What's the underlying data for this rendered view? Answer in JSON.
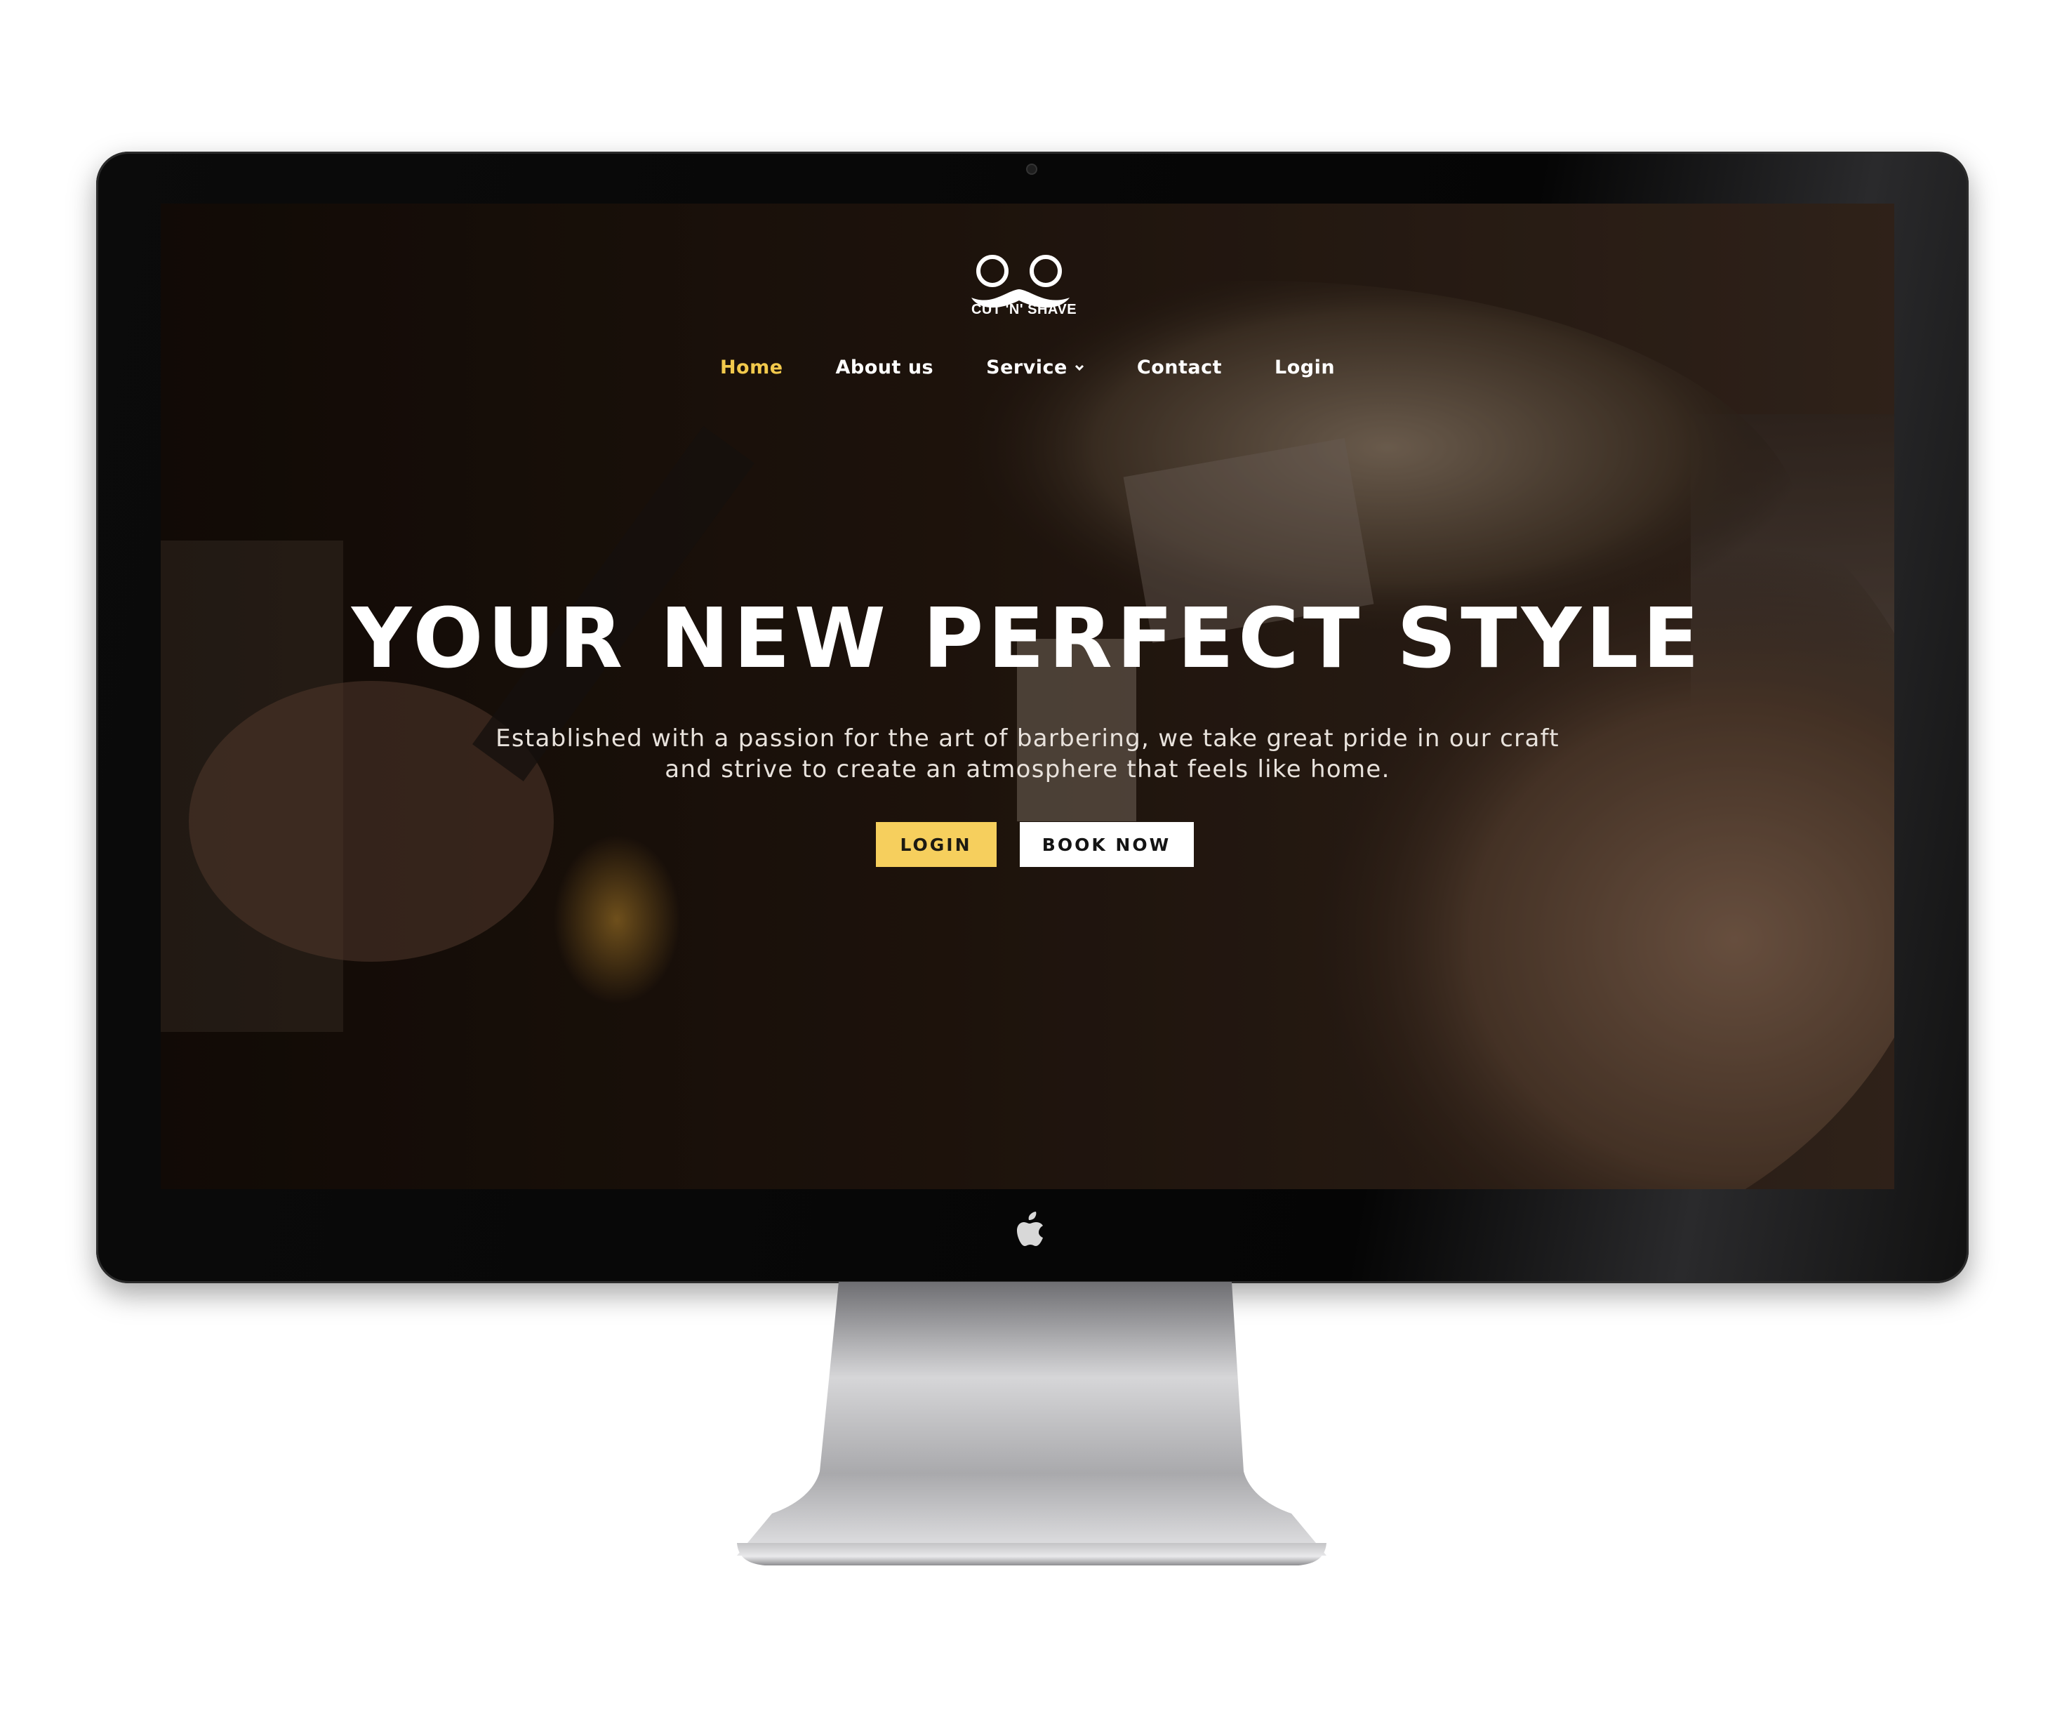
{
  "site": {
    "logo_text": "CUT 'N' SHAVE",
    "logo_icon": "scissors-mustache-icon"
  },
  "nav": {
    "items": [
      {
        "label": "Home",
        "active": true
      },
      {
        "label": "About us",
        "active": false
      },
      {
        "label": "Service",
        "active": false,
        "has_dropdown": true
      },
      {
        "label": "Contact",
        "active": false
      },
      {
        "label": "Login",
        "active": false
      }
    ]
  },
  "hero": {
    "title": "YOUR NEW PERFECT STYLE",
    "subtitle_line1": "Established with a passion for the art of barbering, we take great pride in our craft",
    "subtitle_line2": "and strive to create an atmosphere that feels like home.",
    "login_button": "LOGIN",
    "book_button": "BOOK NOW"
  },
  "colors": {
    "accent": "#f6cf5d",
    "nav_active": "#f2c94c",
    "text": "#ffffff",
    "background_dark": "#1a120c",
    "bezel": "#050505"
  }
}
